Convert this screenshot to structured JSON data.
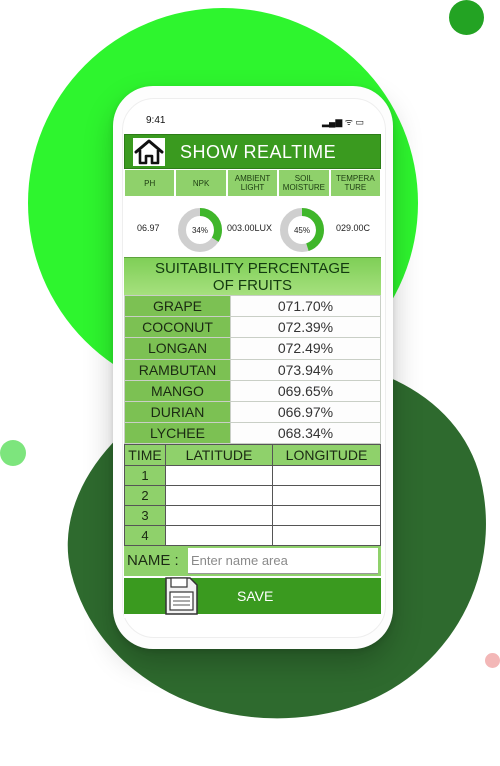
{
  "status_bar": {
    "time": "9:41",
    "icons": "▂▄▆ ᯤ ▭"
  },
  "header": {
    "title": "SHOW  REALTIME"
  },
  "sensors": [
    {
      "label": "PH"
    },
    {
      "label": "NPK"
    },
    {
      "label": "AMBIENT LIGHT"
    },
    {
      "label": "SOIL MOISTURE"
    },
    {
      "label": "TEMPERA TURE"
    }
  ],
  "readings": {
    "ph": "06.97",
    "npk_percent_label": "34%",
    "npk_percent": 34,
    "ambient_light": "003.00LUX",
    "soil_moisture_label": "45%",
    "soil_moisture": 45,
    "temperature": "029.00C"
  },
  "suitability": {
    "title_line1": "SUITABILITY PERCENTAGE",
    "title_line2": "OF FRUITS",
    "fruits": [
      {
        "name": "GRAPE",
        "value": "071.70%"
      },
      {
        "name": "COCONUT",
        "value": "072.39%"
      },
      {
        "name": "LONGAN",
        "value": "072.49%"
      },
      {
        "name": "RAMBUTAN",
        "value": "073.94%"
      },
      {
        "name": "MANGO",
        "value": "069.65%"
      },
      {
        "name": "DURIAN",
        "value": "066.97%"
      },
      {
        "name": "LYCHEE",
        "value": "068.34%"
      }
    ]
  },
  "gps": {
    "headers": [
      "TIME",
      "LATITUDE",
      "LONGITUDE"
    ],
    "rows": [
      {
        "n": "1",
        "lat": "",
        "lon": ""
      },
      {
        "n": "2",
        "lat": "",
        "lon": ""
      },
      {
        "n": "3",
        "lat": "",
        "lon": ""
      },
      {
        "n": "4",
        "lat": "",
        "lon": ""
      }
    ]
  },
  "name_field": {
    "label": "NAME :",
    "placeholder": "Enter name area",
    "value": ""
  },
  "save": {
    "label": "SAVE"
  },
  "colors": {
    "primary_green": "#3a9a1f",
    "light_green": "#8fd16b",
    "donut_fill": "#3fb62a",
    "donut_track": "#cfcfcf"
  },
  "icons": {
    "home": "home-icon",
    "save": "document-save-icon"
  }
}
